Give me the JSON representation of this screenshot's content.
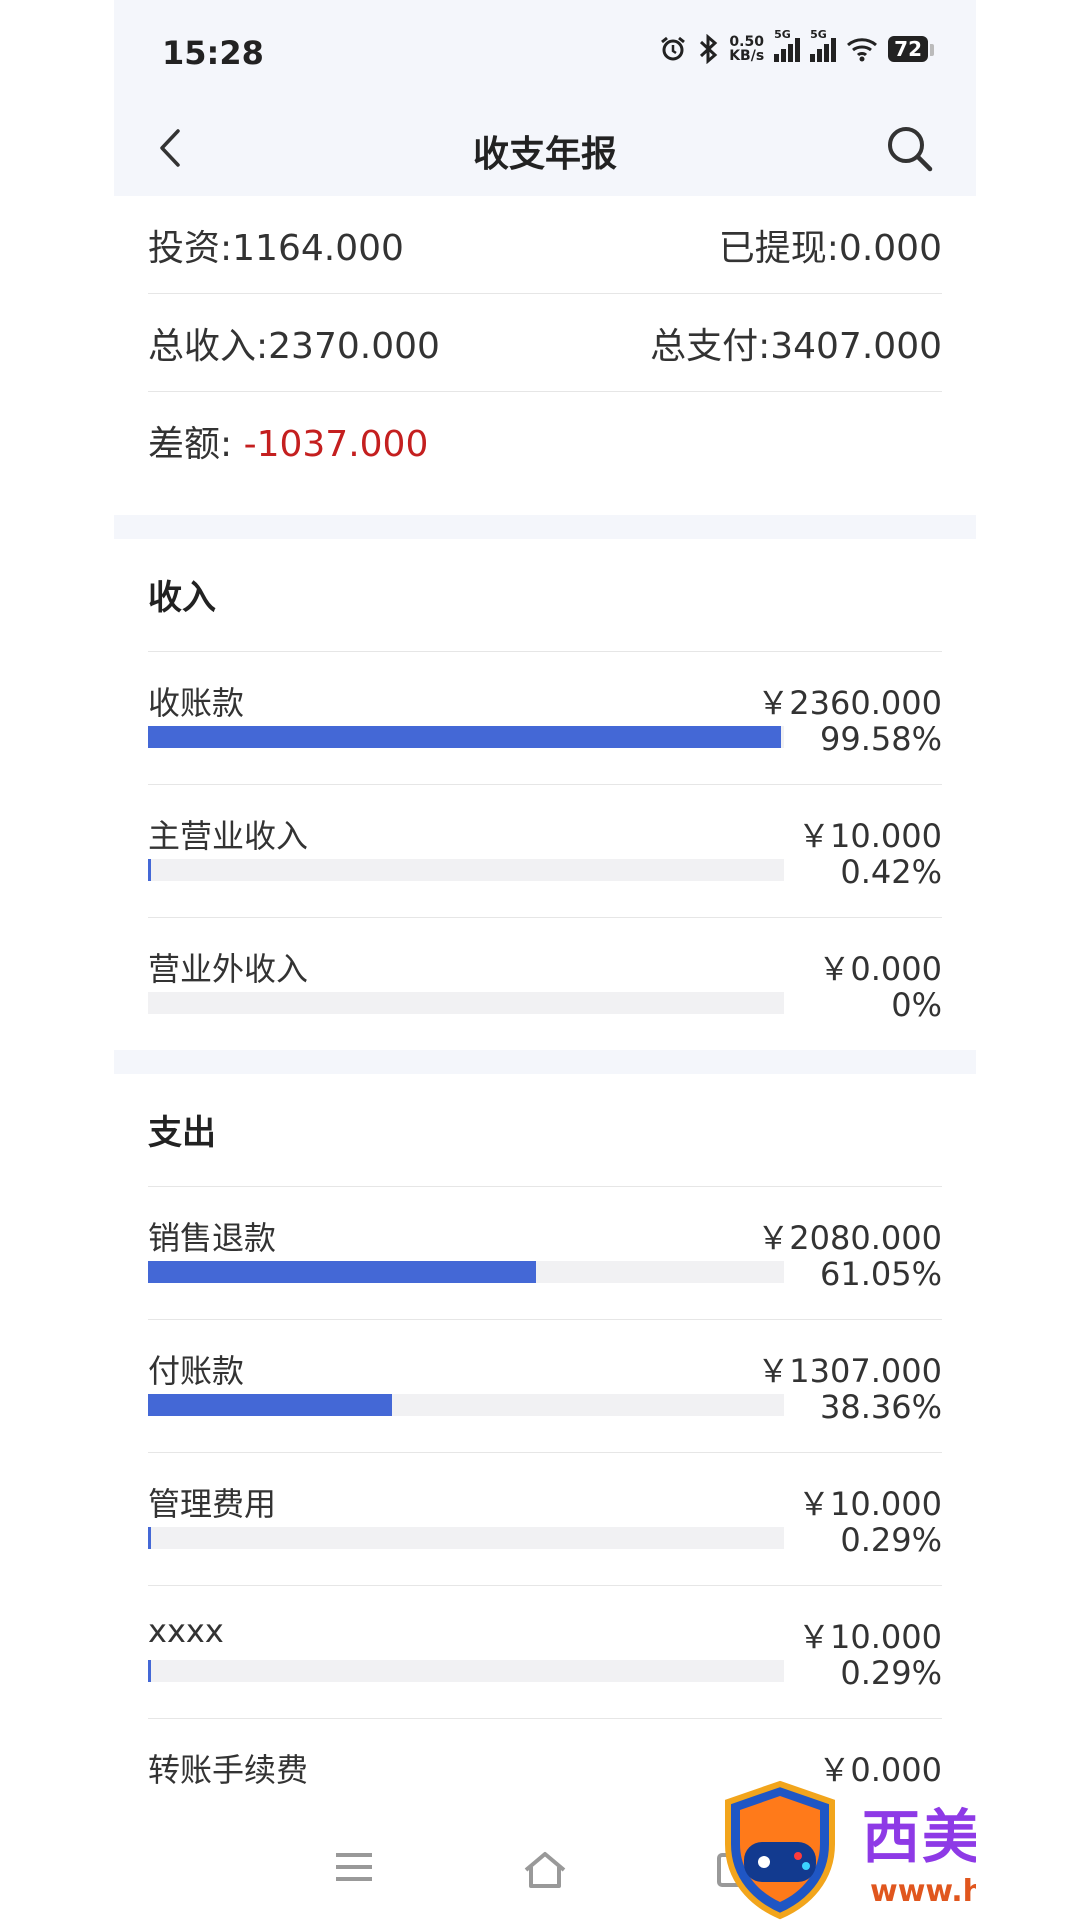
{
  "status_bar": {
    "time": "15:28",
    "net_speed_value": "0.50",
    "net_speed_unit": "KB/s",
    "signal_1_tag": "5G",
    "signal_2_tag": "5G",
    "battery": "72"
  },
  "nav": {
    "title": "收支年报"
  },
  "summary": {
    "investment": "投资:1164.000",
    "withdrawn": "已提现:0.000",
    "total_income": "总收入:2370.000",
    "total_payment": "总支付:3407.000",
    "difference_label": "差额:",
    "difference_value": "-1037.000"
  },
  "income": {
    "title": "收入",
    "items": [
      {
        "label": "收账款",
        "amount": "￥2360.000",
        "percent": "99.58%",
        "fraction": 0.9958
      },
      {
        "label": "主营业收入",
        "amount": "￥10.000",
        "percent": "0.42%",
        "fraction": 0.0042
      },
      {
        "label": "营业外收入",
        "amount": "￥0.000",
        "percent": "0%",
        "fraction": 0
      }
    ]
  },
  "expense": {
    "title": "支出",
    "items": [
      {
        "label": "销售退款",
        "amount": "￥2080.000",
        "percent": "61.05%",
        "fraction": 0.6105
      },
      {
        "label": "付账款",
        "amount": "￥1307.000",
        "percent": "38.36%",
        "fraction": 0.3836
      },
      {
        "label": "管理费用",
        "amount": "￥10.000",
        "percent": "0.29%",
        "fraction": 0.0029
      },
      {
        "label": "xxxx",
        "amount": "￥10.000",
        "percent": "0.29%",
        "fraction": 0.0029
      },
      {
        "label": "转账手续费",
        "amount": "￥0.000",
        "percent": "",
        "fraction": 0
      }
    ]
  },
  "watermark": {
    "title": "西美手游网",
    "url": "www.hanxm.com"
  },
  "colors": {
    "bar_fill": "#4468d6",
    "negative": "#c41f1f",
    "watermark_title": "#8e3ae6",
    "watermark_url": "#e0561e"
  }
}
